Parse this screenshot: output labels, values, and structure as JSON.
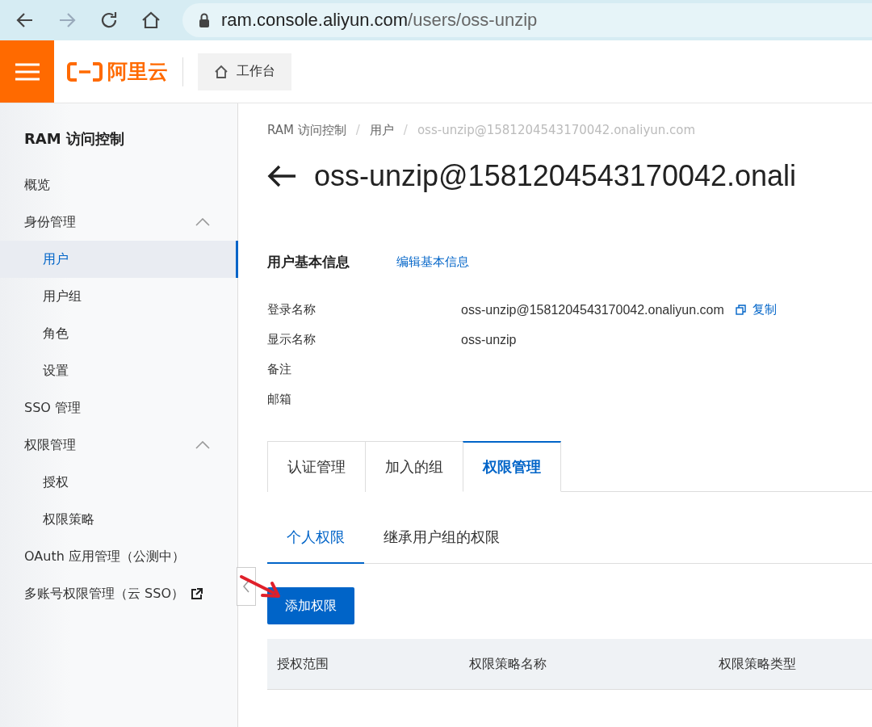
{
  "browser": {
    "url_host": "ram.console.aliyun.com",
    "url_path": "/users/oss-unzip"
  },
  "topbar": {
    "logo_text": "阿里云",
    "workbench": "工作台"
  },
  "sidebar": {
    "title": "RAM 访问控制",
    "items": [
      {
        "label": "概览",
        "selected": false
      },
      {
        "label": "身份管理",
        "selected": false,
        "expanded": true,
        "children": [
          {
            "label": "用户",
            "selected": true
          },
          {
            "label": "用户组",
            "selected": false
          },
          {
            "label": "角色",
            "selected": false
          },
          {
            "label": "设置",
            "selected": false
          }
        ]
      },
      {
        "label": "SSO 管理",
        "selected": false
      },
      {
        "label": "权限管理",
        "selected": false,
        "expanded": true,
        "children": [
          {
            "label": "授权",
            "selected": false
          },
          {
            "label": "权限策略",
            "selected": false
          }
        ]
      },
      {
        "label": "OAuth 应用管理（公测中）",
        "selected": false
      },
      {
        "label": "多账号权限管理（云 SSO）",
        "selected": false,
        "external": true
      }
    ]
  },
  "breadcrumb": {
    "separator": "/",
    "items": [
      "RAM 访问控制",
      "用户",
      "oss-unzip@1581204543170042.onaliyun.com"
    ]
  },
  "page_title": "oss-unzip@1581204543170042.onali",
  "info": {
    "title": "用户基本信息",
    "edit_link": "编辑基本信息",
    "fields": [
      {
        "label": "登录名称",
        "value": "oss-unzip@1581204543170042.onaliyun.com",
        "copy": "复制"
      },
      {
        "label": "显示名称",
        "value": "oss-unzip"
      },
      {
        "label": "备注"
      },
      {
        "label": "邮箱"
      }
    ]
  },
  "tabs": [
    {
      "label": "认证管理",
      "selected": false
    },
    {
      "label": "加入的组",
      "selected": false
    },
    {
      "label": "权限管理",
      "selected": true
    }
  ],
  "subtabs": [
    {
      "label": "个人权限",
      "selected": true
    },
    {
      "label": "继承用户组的权限",
      "selected": false
    }
  ],
  "add_button": "添加权限",
  "table": {
    "columns": [
      "授权范围",
      "权限策略名称",
      "权限策略类型"
    ]
  }
}
